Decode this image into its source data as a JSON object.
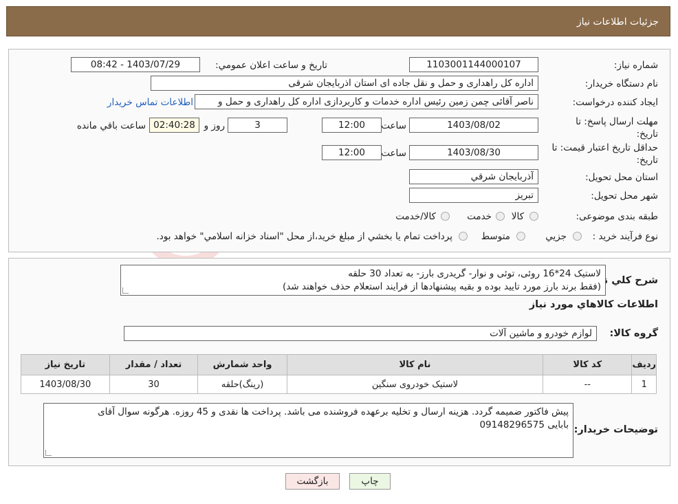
{
  "header": {
    "title": "جزئيات اطلاعات نياز"
  },
  "form": {
    "need_number_label": "شماره نياز:",
    "need_number": "1103001144000107",
    "announce_label": "تاريخ و ساعت اعلان عمومي:",
    "announce_value": "1403/07/29 - 08:42",
    "buyer_label": "نام دستگاه خريدار:",
    "buyer_value": "اداره کل راهداری و حمل و نقل جاده ای استان اذربایجان شرقی",
    "creator_label": "ايجاد کننده درخواست:",
    "creator_value": "ناصر آقائی چمن زمین رئیس اداره خدمات و کاربردازی اداره کل راهداری و حمل و",
    "contact_link": "اطلاعات تماس خريدار",
    "deadline_label": "مهلت ارسال پاسخ: تا تاريخ:",
    "deadline_date": "1403/08/02",
    "time_label": "ساعت",
    "deadline_time": "12:00",
    "days_value": "3",
    "days_label": "روز و",
    "remaining_time": "02:40:28",
    "remaining_label": "ساعت باقي مانده",
    "validity_label": "حداقل تاريخ اعتبار قيمت: تا تاريخ:",
    "validity_date": "1403/08/30",
    "validity_time": "12:00",
    "province_label": "استان محل تحويل:",
    "province_value": "آذربايجان شرقي",
    "city_label": "شهر محل تحويل:",
    "city_value": "تبريز",
    "category_label": "طبقه بندی موضوعی:",
    "category_options": [
      "کالا",
      "خدمت",
      "کالا/خدمت"
    ],
    "purchase_label": "نوع فرآيند خريد :",
    "purchase_options": [
      "جزيي",
      "متوسط"
    ],
    "purchase_note": "پرداخت تمام يا بخشي از مبلغ خريد،از محل \"اسناد خزانه اسلامي\" خواهد بود."
  },
  "details": {
    "summary_label": "شرح کلي نياز:",
    "summary_line1": "لاستیک 24*16 روئی، توئی و نوار- گریدری بارز- به تعداد 30 حلقه",
    "summary_line2": "(فقط برند بارز مورد تایید بوده و بقیه پیشنهادها از فرایند استعلام حذف خواهند شد)",
    "goods_info_title": "اطلاعات کالاهاي مورد نياز",
    "group_label": "گروه کالا:",
    "group_value": "لوازم خودرو و ماشين آلات",
    "table": {
      "headers": [
        "رديف",
        "کد کالا",
        "نام کالا",
        "واحد شمارش",
        "تعداد / مقدار",
        "تاريخ نياز"
      ],
      "rows": [
        [
          "1",
          "--",
          "لاستیک خودروی سنگین",
          "(رینگ)حلقه",
          "30",
          "1403/08/30"
        ]
      ]
    },
    "buyer_notes_label": "توضيحات خريدار:",
    "buyer_notes_line1": "پیش فاکتور ضمیمه گردد. هزینه ارسال و تخلیه برعهده فروشنده می باشد. پرداخت ها نقدی و 45 روزه. هرگونه سوال آقای",
    "buyer_notes_line2": "بابایی 09148296575"
  },
  "buttons": {
    "print": "چاپ",
    "back": "بازگشت"
  },
  "colors": {
    "header_bg": "#8a6b4a",
    "print_bg": "#ebf7e3",
    "back_bg": "#fbe6e6",
    "link": "#1f5fbf"
  }
}
